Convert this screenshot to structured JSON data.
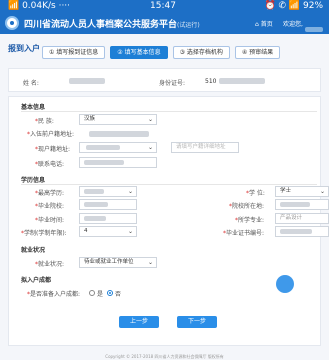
{
  "status_bar": {
    "network": "📶 0.04K/s ····",
    "time": "15:47",
    "indicators": "⏰ ✆ 📶 92%"
  },
  "header": {
    "title": "四川省流动人员人事档案公共服务平台",
    "subtitle": "(试运行)",
    "home": "首页",
    "welcome": "欢迎您,",
    "right_blur": "",
    "brand_color": "#1d6fc6"
  },
  "breadcrumb": "报到入户",
  "steps": [
    {
      "label": "① 填写报到证信息",
      "active": false
    },
    {
      "label": "② 填写基本信息",
      "active": true
    },
    {
      "label": "③ 选择存档机构",
      "active": false
    },
    {
      "label": "④ 预审结果",
      "active": false
    }
  ],
  "identity": {
    "name_label": "姓    名:",
    "id_label": "身份证号:",
    "id_prefix": "510"
  },
  "basic": {
    "section": "基本信息",
    "nation_label": "民    族:",
    "nation_value": "汉族",
    "before_address_label": "入伍前户籍地址:",
    "hukou_address_label": "现户籍地址:",
    "hukou_address_placeholder": "请填写户籍详细地址",
    "phone_label": "联系电话:"
  },
  "education": {
    "section": "学历信息",
    "highest_edu_label": "最高学历:",
    "degree_label": "学    位:",
    "degree_value": "学士",
    "school_label": "毕业院校:",
    "school_place_label": "院校所在地:",
    "grad_time_label": "毕业时间:",
    "major_label": "所学专业:",
    "major_value": "产品设计",
    "years_label": "学制(学制年限):",
    "years_value": "4",
    "diploma_no_label": "毕业证书编号:"
  },
  "employment": {
    "section": "就业状况",
    "status_label": "就业状况:",
    "status_value": "待业或就业工作单位"
  },
  "household": {
    "section": "拟入户成都",
    "question_label": "是否准备入户成都:",
    "options": [
      "是",
      "否"
    ],
    "selected": "否"
  },
  "buttons": {
    "prev": "上一步",
    "next": "下一步"
  },
  "footer": "Copyright © 2017-2018 四川省人力资源和社会保障厅 版权所有"
}
